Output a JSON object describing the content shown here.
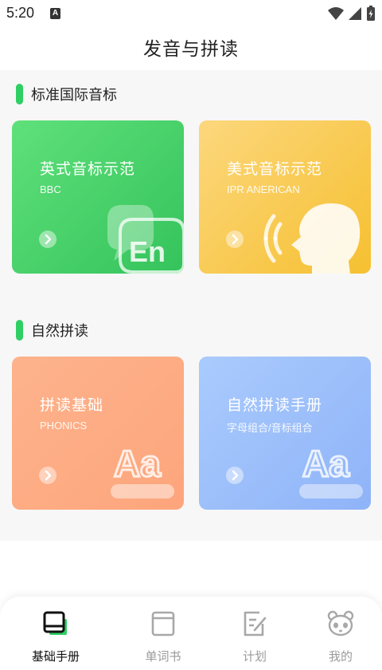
{
  "status_bar": {
    "time": "5:20",
    "indicator": "A",
    "icons": [
      "wifi-icon",
      "signal-icon",
      "battery-charging-icon"
    ]
  },
  "header": {
    "title": "发音与拼读"
  },
  "sections": [
    {
      "title": "标准国际音标",
      "accent": "#2fcf64"
    },
    {
      "title": "自然拼读",
      "accent": "#2fcf64"
    }
  ],
  "cards": [
    {
      "title": "英式音标示范",
      "subtitle": "BBC",
      "icon": "en-speech-bubble-icon",
      "color": "#46cf65"
    },
    {
      "title": "美式音标示范",
      "subtitle": "IPR ANERICAN",
      "icon": "speaking-head-icon",
      "color": "#f8c845"
    },
    {
      "title": "拼读基础",
      "subtitle": "PHONICS",
      "icon": "aa-letters-icon",
      "color": "#fdab84"
    },
    {
      "title": "自然拼读手册",
      "subtitle": "字母组合/音标组合",
      "icon": "aa-letters-icon",
      "color": "#9dbefa"
    }
  ],
  "tabbar": {
    "active_index": 0,
    "tabs": [
      {
        "label": "基础手册",
        "icon": "book-icon"
      },
      {
        "label": "单词书",
        "icon": "wordbook-icon"
      },
      {
        "label": "计划",
        "icon": "plan-edit-icon"
      },
      {
        "label": "我的",
        "icon": "panda-icon"
      }
    ]
  },
  "colors": {
    "accent_green": "#2fcf64",
    "tab_active_text": "#111111",
    "tab_inactive_text": "#9a9a9a"
  }
}
